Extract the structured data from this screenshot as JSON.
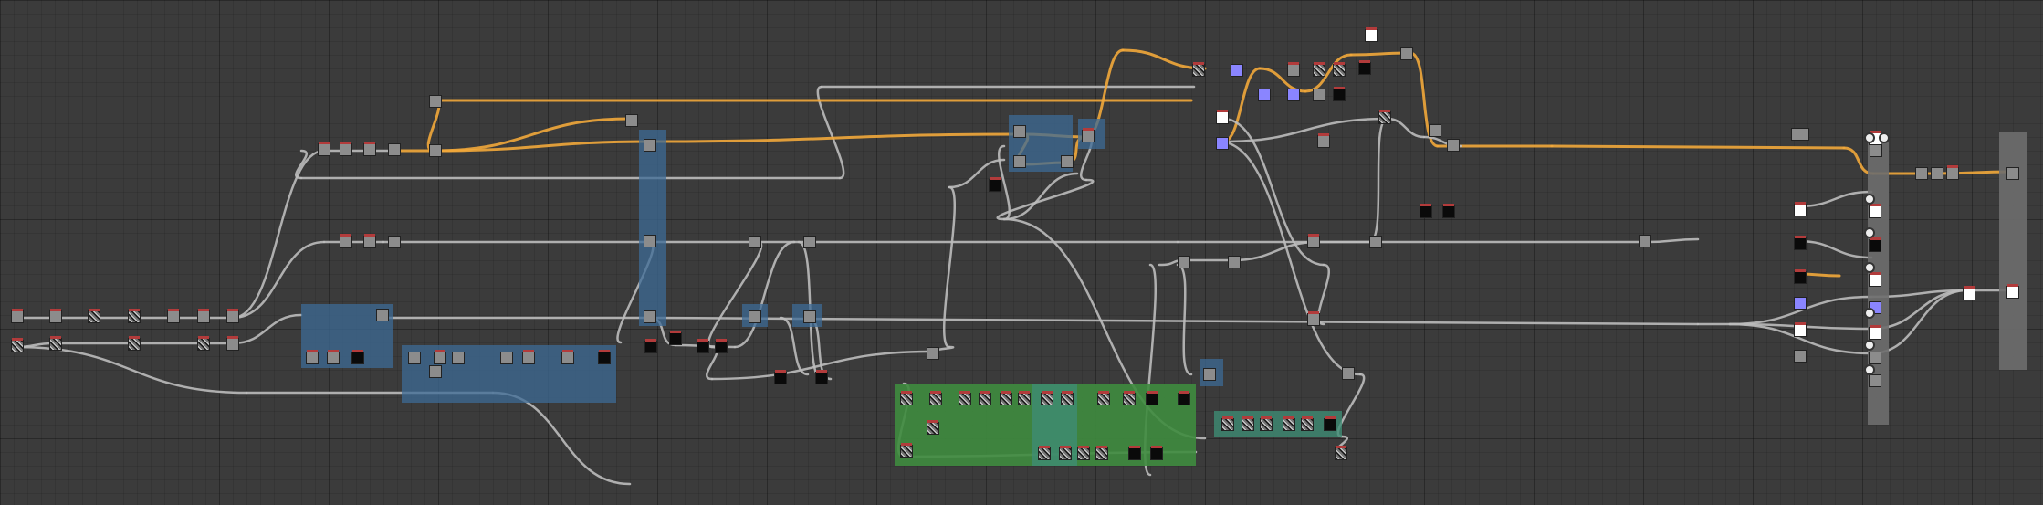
{
  "graph": {
    "colors": {
      "background": "#3b3b3b",
      "link_default": "#bdbdbd",
      "link_highlight": "#f2a93b",
      "frame_blue": "#3d6b96",
      "frame_green": "#3f8c3f",
      "frame_teal": "#3e8c74",
      "node_gray": "#8c8c8c",
      "node_purple": "#8a85ff",
      "node_white": "#ffffff",
      "node_black": "#0a0a0a",
      "node_header_red": "#b23b3b"
    },
    "frame_count": 12,
    "node_count": 150
  }
}
